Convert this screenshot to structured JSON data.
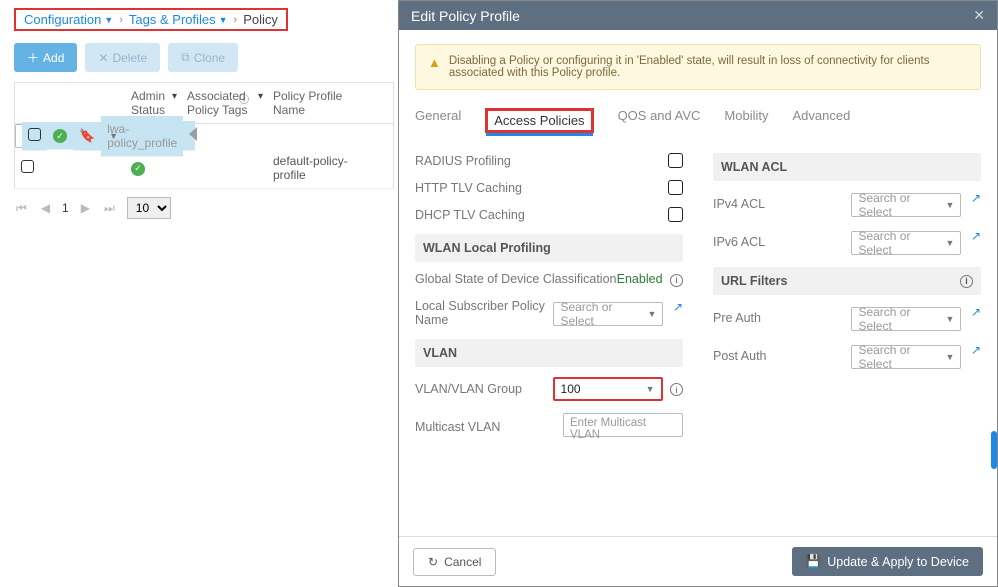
{
  "breadcrumb": {
    "configuration": "Configuration",
    "tags_profiles": "Tags & Profiles",
    "policy": "Policy"
  },
  "toolbar": {
    "add": "Add",
    "delete": "Delete",
    "clone": "Clone"
  },
  "table": {
    "headers": {
      "admin_status": "Admin Status",
      "assoc_tags": "Associated Policy Tags",
      "profile_name": "Policy Profile Name"
    },
    "rows": [
      {
        "name": "lwa-policy_profile",
        "selected": true
      },
      {
        "name": "default-policy-profile",
        "selected": false
      }
    ]
  },
  "pager": {
    "page": "1",
    "size": "10"
  },
  "modal": {
    "title": "Edit Policy Profile",
    "warning": "Disabling a Policy or configuring it in 'Enabled' state, will result in loss of connectivity for clients associated with this Policy profile.",
    "tabs": {
      "general": "General",
      "access": "Access Policies",
      "qos": "QOS and AVC",
      "mobility": "Mobility",
      "advanced": "Advanced"
    },
    "left": {
      "radius": "RADIUS Profiling",
      "http": "HTTP TLV Caching",
      "dhcp": "DHCP TLV Caching",
      "local_prof_head": "WLAN Local Profiling",
      "global_state": "Global State of Device Classification",
      "global_state_val": "Enabled",
      "lspn": "Local Subscriber Policy Name",
      "lspn_ph": "Search or Select",
      "vlan_head": "VLAN",
      "vlan_group": "VLAN/VLAN Group",
      "vlan_value": "100",
      "mcast": "Multicast VLAN",
      "mcast_ph": "Enter Multicast VLAN"
    },
    "right": {
      "wlan_acl_head": "WLAN ACL",
      "ipv4": "IPv4 ACL",
      "ipv6": "IPv6 ACL",
      "url_head": "URL Filters",
      "pre": "Pre Auth",
      "post": "Post Auth",
      "sel_ph": "Search or Select"
    },
    "footer": {
      "cancel": "Cancel",
      "apply": "Update & Apply to Device"
    }
  }
}
